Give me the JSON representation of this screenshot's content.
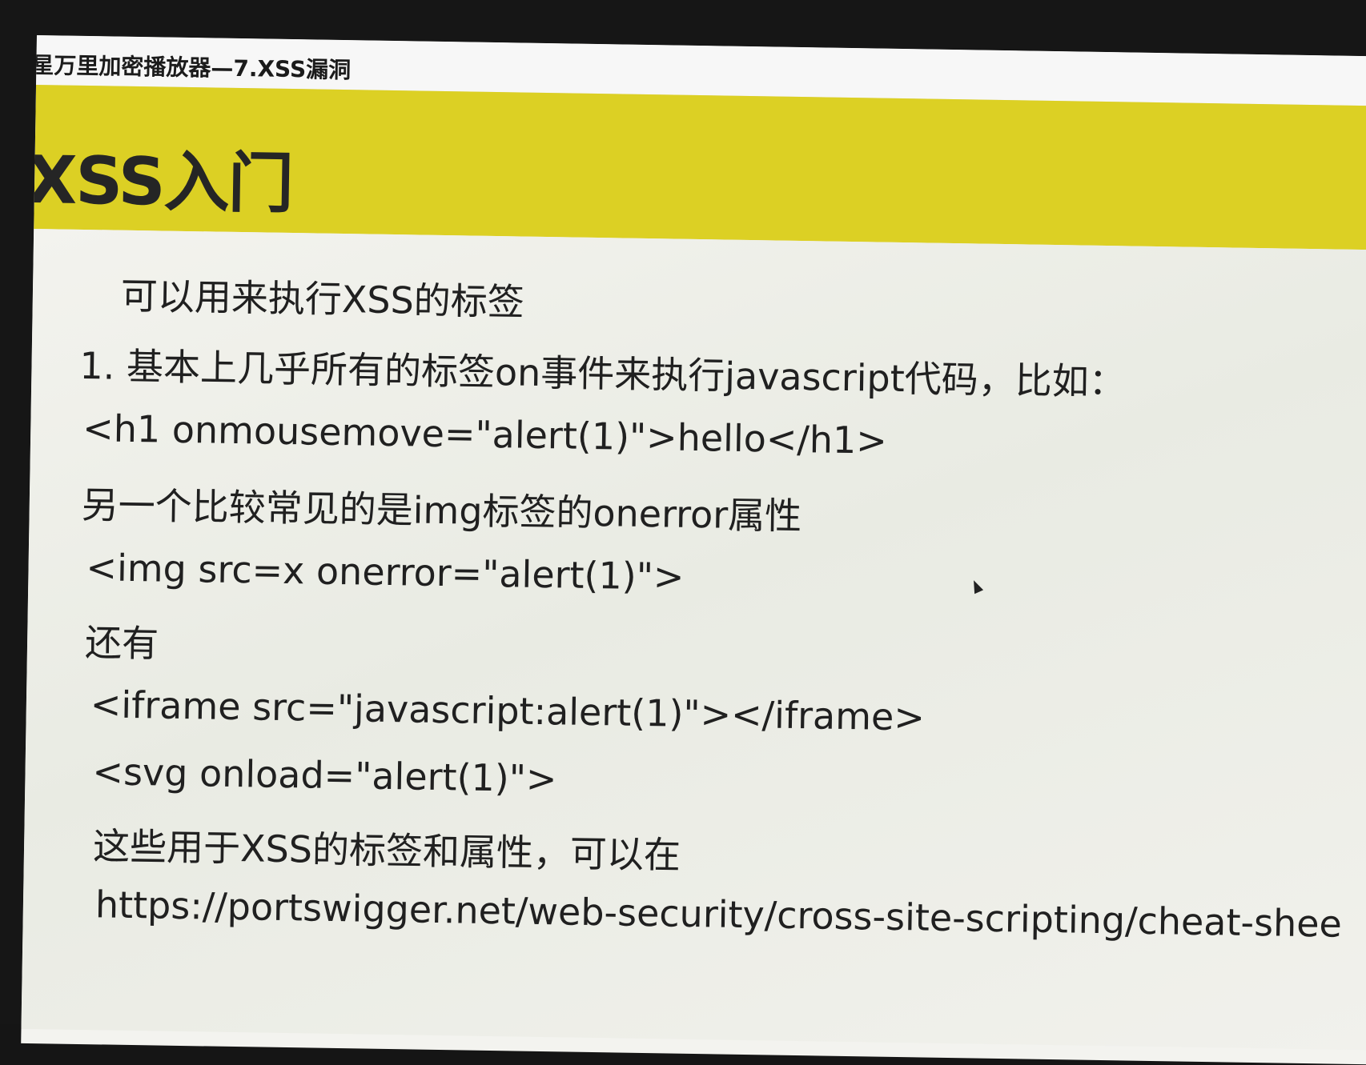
{
  "window": {
    "title": "星万里加密播放器—7.XSS漏洞"
  },
  "slide": {
    "title": "XSS入门",
    "heading": "可以用来执行XSS的标签",
    "lines": [
      "1. 基本上几乎所有的标签on事件来执行javascript代码，比如：",
      "<h1 onmousemove=\"alert(1)\">hello</h1>",
      "另一个比较常见的是img标签的onerror属性",
      "<img src=x onerror=\"alert(1)\">",
      "还有",
      "<iframe src=\"javascript:alert(1)\"></iframe>",
      "<svg onload=\"alert(1)\">",
      "这些用于XSS的标签和属性，可以在",
      "https://portswigger.net/web-security/cross-site-scripting/cheat-shee"
    ]
  }
}
